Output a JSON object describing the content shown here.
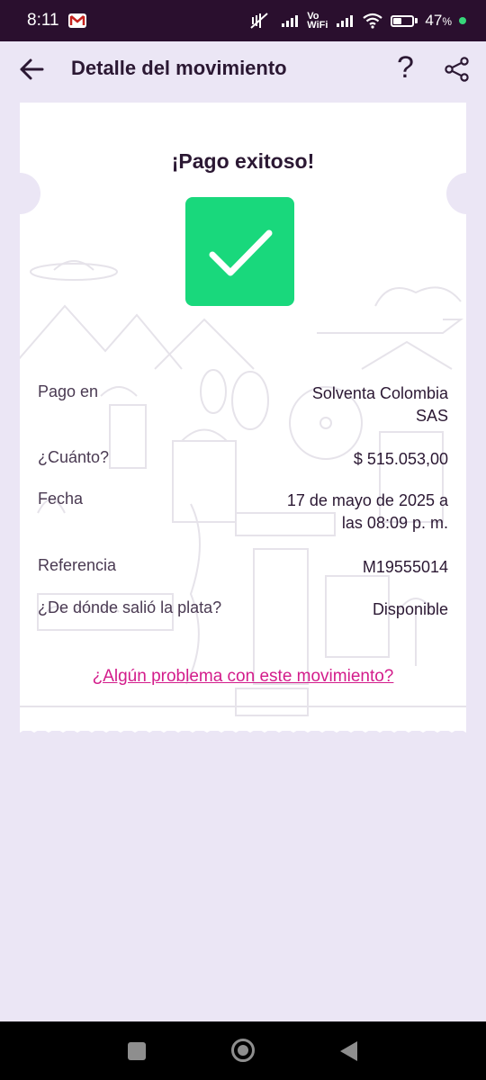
{
  "status_bar": {
    "time": "8:11",
    "notification_icon": "gmail-icon",
    "network_label_top": "Vo",
    "network_label_bottom": "WiFi",
    "battery_percent": "47",
    "battery_suffix": "%",
    "battery_level": 0.47,
    "charging_dot_color": "#37d67a"
  },
  "app_bar": {
    "title": "Detalle del movimiento",
    "back_icon": "arrow-left-icon",
    "help_label": "?",
    "share_icon": "share-icon"
  },
  "receipt": {
    "headline": "¡Pago exitoso!",
    "status_icon": "check-icon",
    "status_color": "#19d87c",
    "rows": [
      {
        "label": "Pago en",
        "value_line1": "Solventa Colombia",
        "value_line2": "SAS"
      },
      {
        "label": "¿Cuánto?",
        "value_line1": "$ 515.053,00",
        "value_line2": ""
      },
      {
        "label": "Fecha",
        "value_line1": "17 de mayo de 2025 a",
        "value_line2": "las 08:09 p. m."
      },
      {
        "label": "Referencia",
        "value_line1": "M19555014",
        "value_line2": ""
      },
      {
        "label": "¿De dónde salió la plata?",
        "value_line1": "Disponible",
        "value_line2": ""
      }
    ],
    "problem_link": "¿Algún problema con este movimiento?",
    "link_color": "#d31c8b"
  },
  "colors": {
    "background": "#ebe6f5",
    "status_bar": "#2a0f2e",
    "text": "#2b1833"
  }
}
